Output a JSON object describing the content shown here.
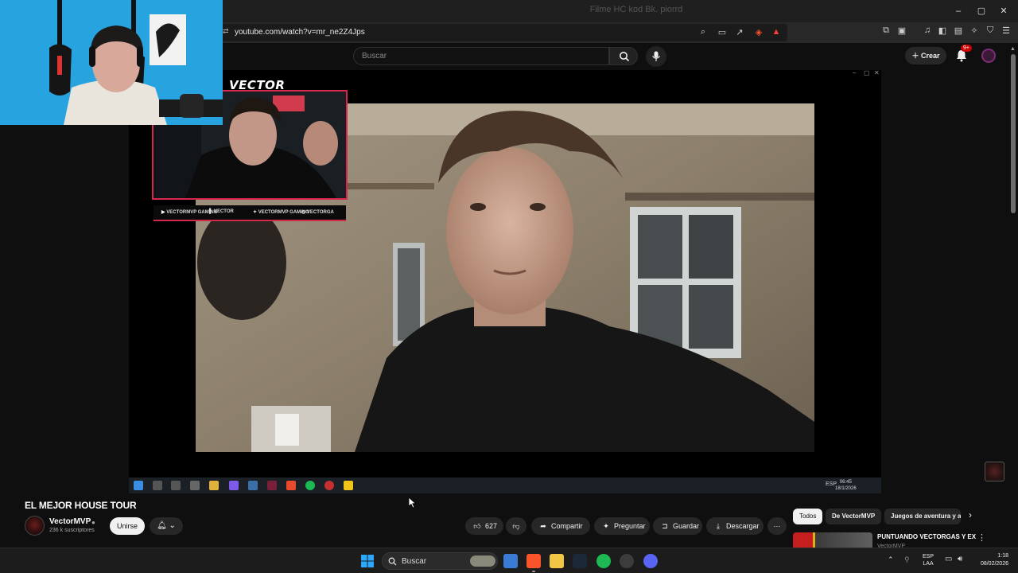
{
  "browser": {
    "window_title": "Filme HC kod Bk. piorrd",
    "url": "youtube.com/watch?v=mr_ne2Z4Jps"
  },
  "youtube": {
    "search_placeholder": "Buscar",
    "create_label": "Crear",
    "notification_count": "9+"
  },
  "stream_overlay": {
    "logo_text": "VECTOR",
    "socials": [
      "VECTORMVP GAMING",
      "VECTOR",
      "VECTORMVP GAMING",
      "VECTORGA"
    ]
  },
  "inner_taskbar": {
    "lang": "ESP",
    "time": "06:45",
    "date": "18/1/2026"
  },
  "video": {
    "title": "EL MEJOR HOUSE TOUR",
    "channel_name": "VectorMVP",
    "subscribers": "236 k suscriptores",
    "join_label": "Unirse",
    "like_count": "627",
    "share_label": "Compartir",
    "ask_label": "Preguntar",
    "save_label": "Guardar",
    "download_label": "Descargar"
  },
  "sidebar": {
    "chips": [
      "Todos",
      "De VectorMVP",
      "Juegos de aventura y a"
    ],
    "rec_title": "PUNTUANDO VECTORGAS Y EX",
    "rec_channel": "VectorMVP"
  },
  "os_taskbar": {
    "search_label": "Buscar",
    "lang_top": "ESP",
    "lang_bottom": "LAA",
    "time": "1:18",
    "date": "08/02/2026"
  },
  "colors": {
    "accent_red": "#cc0000",
    "overlay_border": "#d5284a",
    "webcam_bg": "#2aa9e6"
  }
}
